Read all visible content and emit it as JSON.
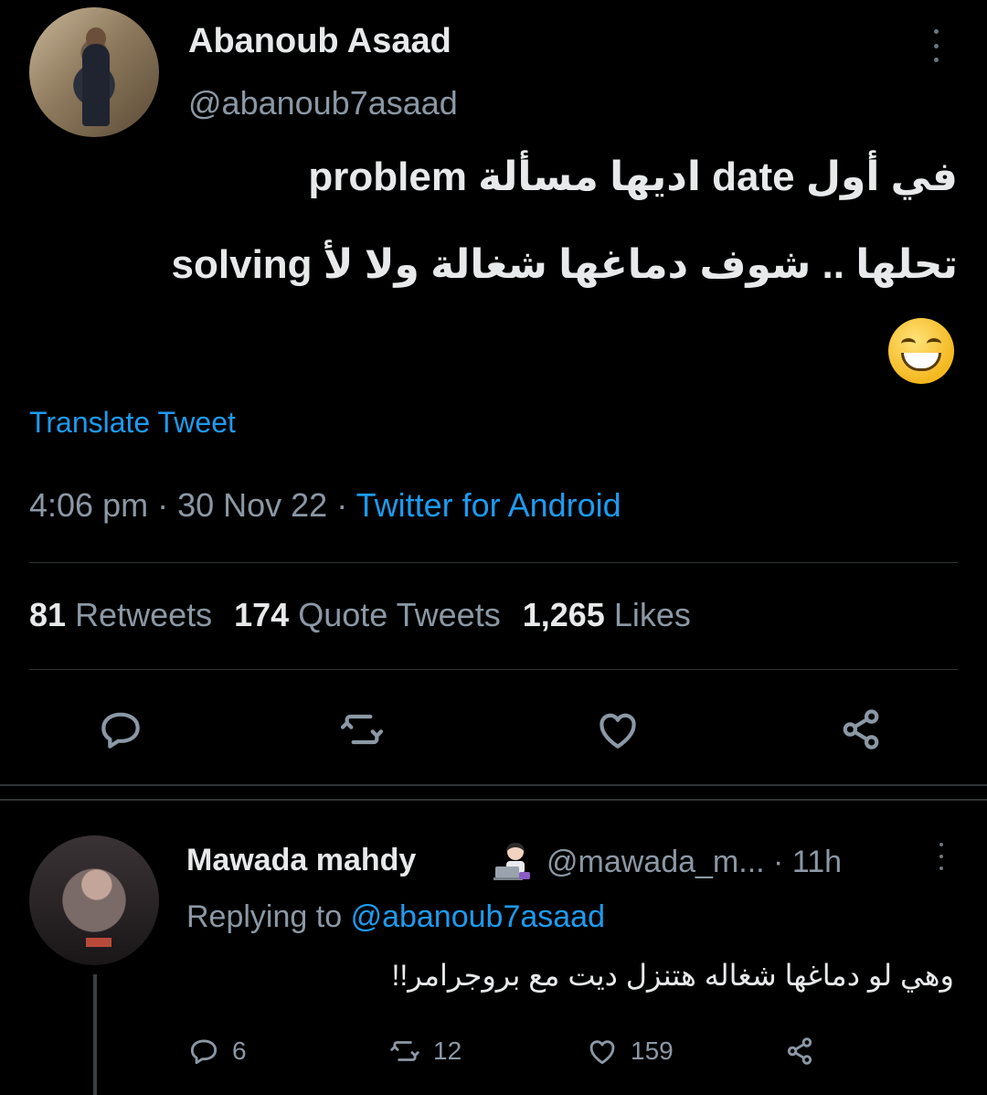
{
  "tweet": {
    "author_name": "Abanoub Asaad",
    "author_handle": "@abanoub7asaad",
    "text_line1": "في أول date اديها مسألة problem",
    "text_line2": "تحلها .. شوف دماغها شغالة ولا لأ solving",
    "emoji": "grinning-face-with-smiling-eyes",
    "translate_label": "Translate Tweet",
    "time": "4:06 pm",
    "date": "30 Nov 22",
    "source": "Twitter for Android",
    "stats": {
      "retweets_count": "81",
      "retweets_label": "Retweets",
      "quotes_count": "174",
      "quotes_label": "Quote Tweets",
      "likes_count": "1,265",
      "likes_label": "Likes"
    },
    "actions": [
      "reply-icon",
      "retweet-icon",
      "like-icon",
      "share-icon"
    ]
  },
  "reply": {
    "author_name": "Mawada mahdy",
    "author_emoji": "woman-technologist",
    "author_handle": "@mawada_m...",
    "time": "11h",
    "replying_label": "Replying to",
    "replying_to": "@abanoub7asaad",
    "text": "وهي لو دماغها شغاله هتنزل ديت مع بروجرامر!!",
    "counts": {
      "replies": "6",
      "retweets": "12",
      "likes": "159"
    }
  },
  "colors": {
    "background": "#000000",
    "text": "#e7e9ea",
    "muted": "#8b98a5",
    "accent": "#1d9bf0"
  }
}
